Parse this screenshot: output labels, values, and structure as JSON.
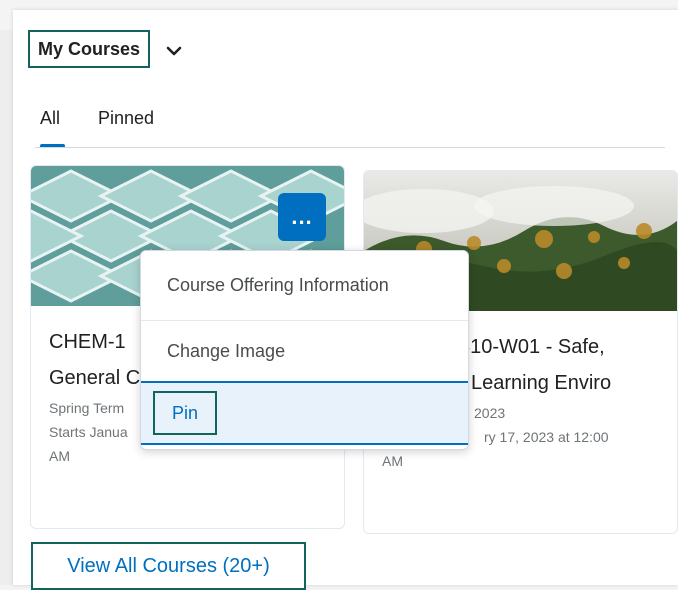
{
  "header": {
    "title": "My Courses",
    "dropdown_icon": "chevron-down-icon"
  },
  "tabs": [
    {
      "label": "All",
      "active": true
    },
    {
      "label": "Pinned",
      "active": false
    }
  ],
  "cards": [
    {
      "title_line1": "CHEM-1",
      "title_line2": "General C",
      "term": "Spring Term",
      "starts": "Starts Janua",
      "time_suffix": "AM",
      "image": "teal-geometric-pattern"
    },
    {
      "title_line1": "310-W01 - Safe,",
      "title_line2": "Learning Enviro",
      "term": "2023",
      "starts": "ry 17, 2023 at 12:00",
      "time_suffix": "AM",
      "image": "foggy-forest"
    }
  ],
  "course_menu": {
    "more_button_label": "...",
    "items": [
      {
        "label": "Course Offering Information"
      },
      {
        "label": "Change Image"
      },
      {
        "label": "Pin"
      }
    ]
  },
  "footer": {
    "view_all_label": "View All Courses (20+)"
  },
  "colors": {
    "accent": "#006fbf",
    "highlight_border": "#13635f",
    "menu_selected_bg": "#e8f2fb"
  }
}
